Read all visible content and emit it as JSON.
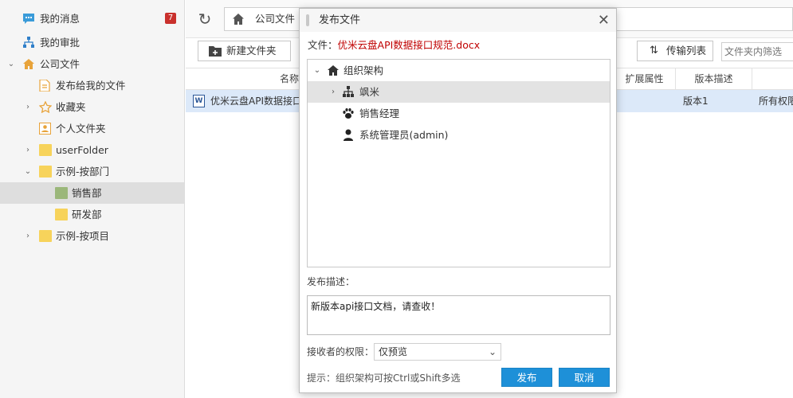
{
  "sidebar": {
    "items": [
      {
        "label": "我的消息",
        "badge": "7",
        "icon": "message-icon"
      },
      {
        "label": "我的审批",
        "icon": "org-tree-icon"
      },
      {
        "label": "公司文件",
        "icon": "home-icon",
        "expanded": true
      },
      {
        "label": "发布给我的文件",
        "icon": "document-icon"
      },
      {
        "label": "收藏夹",
        "icon": "star-icon"
      },
      {
        "label": "个人文件夹",
        "icon": "user-folder-icon"
      },
      {
        "label": "userFolder",
        "icon": "folder-icon"
      },
      {
        "label": "示例-按部门",
        "icon": "folder-icon",
        "expanded": true
      },
      {
        "label": "销售部",
        "icon": "folder-icon",
        "selected": true
      },
      {
        "label": "研发部",
        "icon": "folder-icon"
      },
      {
        "label": "示例-按项目",
        "icon": "folder-icon"
      }
    ]
  },
  "toolbar": {
    "breadcrumb": "公司文件",
    "new_folder_label": "新建文件夹",
    "transfer_list_label": "传输列表",
    "filter_placeholder": "文件夹内筛选"
  },
  "table": {
    "columns": [
      "名称",
      "扩展属性",
      "版本描述"
    ],
    "rows": [
      {
        "name": "优米云盘API数据接口",
        "version": "版本1",
        "permission": "所有权限"
      }
    ]
  },
  "dialog": {
    "title": "发布文件",
    "file_label": "文件：",
    "file_name": "优米云盘API数据接口规范.docx",
    "tree": [
      {
        "label": "组织架构",
        "icon": "home-icon",
        "expanded": true
      },
      {
        "label": "飒米",
        "icon": "org-tree-icon",
        "highlighted": true
      },
      {
        "label": "销售经理",
        "icon": "paw-icon"
      },
      {
        "label": "系统管理员(admin)",
        "icon": "user-icon"
      }
    ],
    "desc_label": "发布描述：",
    "desc_value": "新版本api接口文档，请查收！",
    "permission_label": "接收者的权限：",
    "permission_value": "仅预览",
    "hint": "提示：组织架构可按Ctrl或Shift多选",
    "publish_label": "发布",
    "cancel_label": "取消"
  },
  "colors": {
    "accent": "#1e90d8",
    "badge": "#c9302c",
    "file_name": "#c00000",
    "selected_row": "#dce9f9"
  }
}
